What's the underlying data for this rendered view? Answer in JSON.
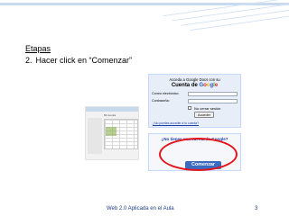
{
  "slide": {
    "heading": "Etapas",
    "step_number": "2.",
    "step_text": "Hacer click en “Comenzar”",
    "footer": "Web 2.0 Aplicada en el Aula",
    "page": "3"
  },
  "screenshot": {
    "docs_tab": "Mi cuenta",
    "signin": {
      "access_text": "Acceda a Google Docs con su",
      "account_prefix": "Cuenta de ",
      "email_label": "Correo electrónico:",
      "password_label": "Contraseña:",
      "remember_label": "No cerrar sesión",
      "submit_label": "Acceder",
      "forgot_link": "¿No puedes acceder a tu cuenta?"
    },
    "no_account": {
      "question": "¿No tienes una cuenta de Google?",
      "start_button": "Comenzar"
    }
  },
  "colors": {
    "highlight_ring": "#e3161b",
    "start_button": "#3a6bc0",
    "link": "#1a3fa6",
    "footer_text": "#1f3e87"
  }
}
